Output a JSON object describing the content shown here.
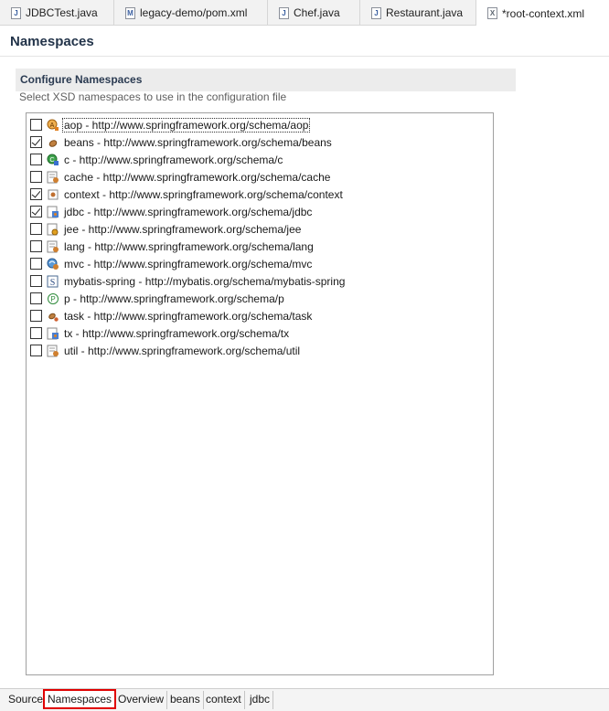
{
  "tabs": [
    {
      "label": "JDBCTest.java",
      "icon": "java-file-icon"
    },
    {
      "label": "legacy-demo/pom.xml",
      "icon": "maven-file-icon"
    },
    {
      "label": "Chef.java",
      "icon": "java-file-icon"
    },
    {
      "label": "Restaurant.java",
      "icon": "java-file-icon"
    },
    {
      "label": "*root-context.xml",
      "icon": "xml-file-icon"
    }
  ],
  "page": {
    "title": "Namespaces"
  },
  "section": {
    "title": "Configure Namespaces",
    "description": "Select XSD namespaces to use in the configuration file"
  },
  "namespaces": [
    {
      "label": "aop - http://www.springframework.org/schema/aop",
      "checked": false,
      "icon": "aop-icon"
    },
    {
      "label": "beans - http://www.springframework.org/schema/beans",
      "checked": true,
      "icon": "bean-icon"
    },
    {
      "label": "c - http://www.springframework.org/schema/c",
      "checked": false,
      "icon": "c-icon"
    },
    {
      "label": "cache - http://www.springframework.org/schema/cache",
      "checked": false,
      "icon": "cache-icon"
    },
    {
      "label": "context - http://www.springframework.org/schema/context",
      "checked": true,
      "icon": "context-icon"
    },
    {
      "label": "jdbc - http://www.springframework.org/schema/jdbc",
      "checked": true,
      "icon": "jdbc-icon"
    },
    {
      "label": "jee - http://www.springframework.org/schema/jee",
      "checked": false,
      "icon": "jee-icon"
    },
    {
      "label": "lang - http://www.springframework.org/schema/lang",
      "checked": false,
      "icon": "lang-icon"
    },
    {
      "label": "mvc - http://www.springframework.org/schema/mvc",
      "checked": false,
      "icon": "mvc-icon"
    },
    {
      "label": "mybatis-spring - http://mybatis.org/schema/mybatis-spring",
      "checked": false,
      "icon": "mybatis-icon"
    },
    {
      "label": "p - http://www.springframework.org/schema/p",
      "checked": false,
      "icon": "p-icon"
    },
    {
      "label": "task - http://www.springframework.org/schema/task",
      "checked": false,
      "icon": "task-icon"
    },
    {
      "label": "tx - http://www.springframework.org/schema/tx",
      "checked": false,
      "icon": "tx-icon"
    },
    {
      "label": "util - http://www.springframework.org/schema/util",
      "checked": false,
      "icon": "util-icon"
    }
  ],
  "bottom_tabs": [
    {
      "label": "Source"
    },
    {
      "label": "Namespaces"
    },
    {
      "label": "Overview"
    },
    {
      "label": "beans"
    },
    {
      "label": "context"
    },
    {
      "label": "jdbc"
    }
  ],
  "colors": {
    "highlight_border": "#e00000",
    "header_bg": "#ececec",
    "title_text": "#23344a"
  }
}
